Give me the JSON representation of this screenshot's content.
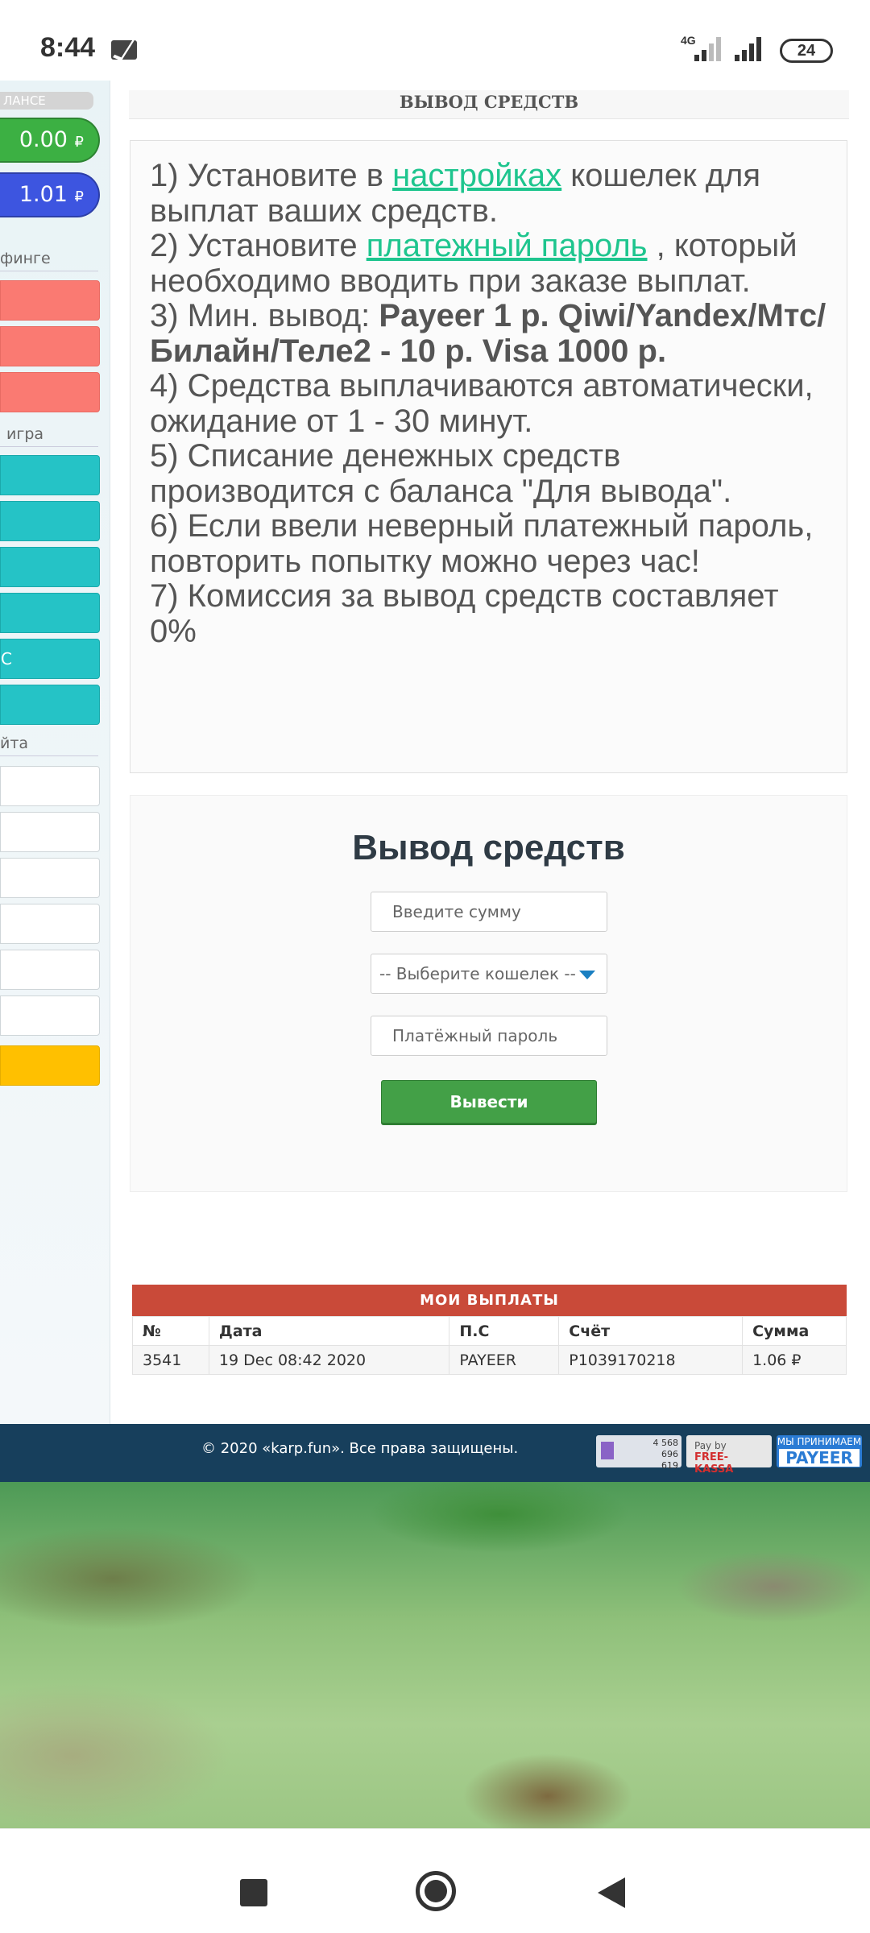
{
  "status_bar": {
    "time": "8:44",
    "network": "4G",
    "battery": "24"
  },
  "sidebar": {
    "balance_label": "ЛАНСЕ",
    "balance_withdraw": "0.00",
    "balance_purchase": "1.01",
    "currency_symbol": "₽",
    "section_surfing": "финге",
    "section_game": "игра",
    "game_item_5": "С",
    "section_site": "йта"
  },
  "page": {
    "title": "ВЫВОД СРЕДСТВ"
  },
  "info": {
    "line1_start": "1) Установите в ",
    "line1_link": "настройках",
    "line1_end": " кошелек для выплат ваших средств.",
    "line2_start": "2) Установите ",
    "line2_link": "платежный пароль",
    "line2_end": " , который необходимо вводить при заказе выплат.",
    "line3_start": "3) Мин. вывод: ",
    "line3_bold": "Payeer 1 р. Qiwi/Yandex/Мтс/Билайн/Теле2 - 10 р. Visa 1000 р.",
    "line4": "4) Средства выплачиваются автоматически, ожидание от 1 - 30 минут.",
    "line5": "5) Списание денежных средств производится с баланса \"Для вывода\".",
    "line6": "6) Если ввели неверный платежный пароль, повторить попытку можно через час!",
    "line7": "7) Комиссия за вывод средств составляет 0%"
  },
  "form": {
    "title": "Вывод средств",
    "amount_placeholder": "Введите сумму",
    "wallet_select": "-- Выберите кошелек --",
    "password_placeholder": "Платёжный пароль",
    "submit_label": "Вывести"
  },
  "payouts": {
    "header": "МОИ ВЫПЛАТЫ",
    "columns": [
      "№",
      "Дата",
      "П.С",
      "Счёт",
      "Сумма"
    ],
    "rows": [
      [
        "3541",
        "19 Dec 08:42 2020",
        "PAYEER",
        "P1039170218",
        "1.06 ₽"
      ]
    ]
  },
  "footer": {
    "copyright": "© 2020 «karp.fun». Все права защищены.",
    "counter_line1": "4 568",
    "counter_line2": "696",
    "counter_line3": "619",
    "freekassa_top": "Pay by",
    "freekassa_brand": "FREE-KASSA",
    "payeer_top": "МЫ ПРИНИМАЕМ",
    "payeer_brand": "PAYEER"
  },
  "colors": {
    "link": "#1ec58e",
    "submit": "#43a047",
    "payouts_header": "#c94a39",
    "footer": "#173f5c",
    "balance_green": "#3cb043",
    "balance_blue": "#3d55e0"
  }
}
